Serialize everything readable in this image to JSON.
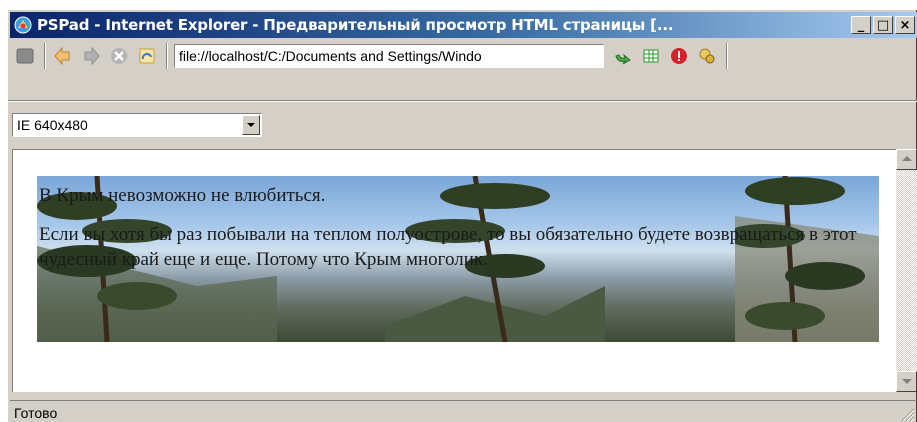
{
  "window": {
    "title": "PSPad - Internet Explorer - Предварительный просмотр HTML страницы  [...",
    "minimize_glyph": "_",
    "maximize_glyph": "□",
    "close_glyph": "×"
  },
  "toolbar": {
    "url": "file://localhost/C:/Documents and Settings/Windo",
    "buttons": [
      "stop-icon",
      "back-icon",
      "forward-icon",
      "cancel-icon",
      "refresh-icon",
      "go-icon",
      "grid-icon",
      "warning-icon",
      "settings-icon"
    ]
  },
  "view": {
    "size_selected": "IE 640x480"
  },
  "page": {
    "heading": "В Крым невозможно не влюбиться.",
    "paragraph": "Если вы хотя бы раз побывали на теплом полуострове, то вы обязательно будете возвращаться в этот чудесный край еще и еще. Потому что Крым многолик."
  },
  "status": {
    "text": "Готово"
  },
  "colors": {
    "title_start": "#0a246a",
    "title_end": "#a6caf0",
    "chrome": "#d4d0c8"
  }
}
